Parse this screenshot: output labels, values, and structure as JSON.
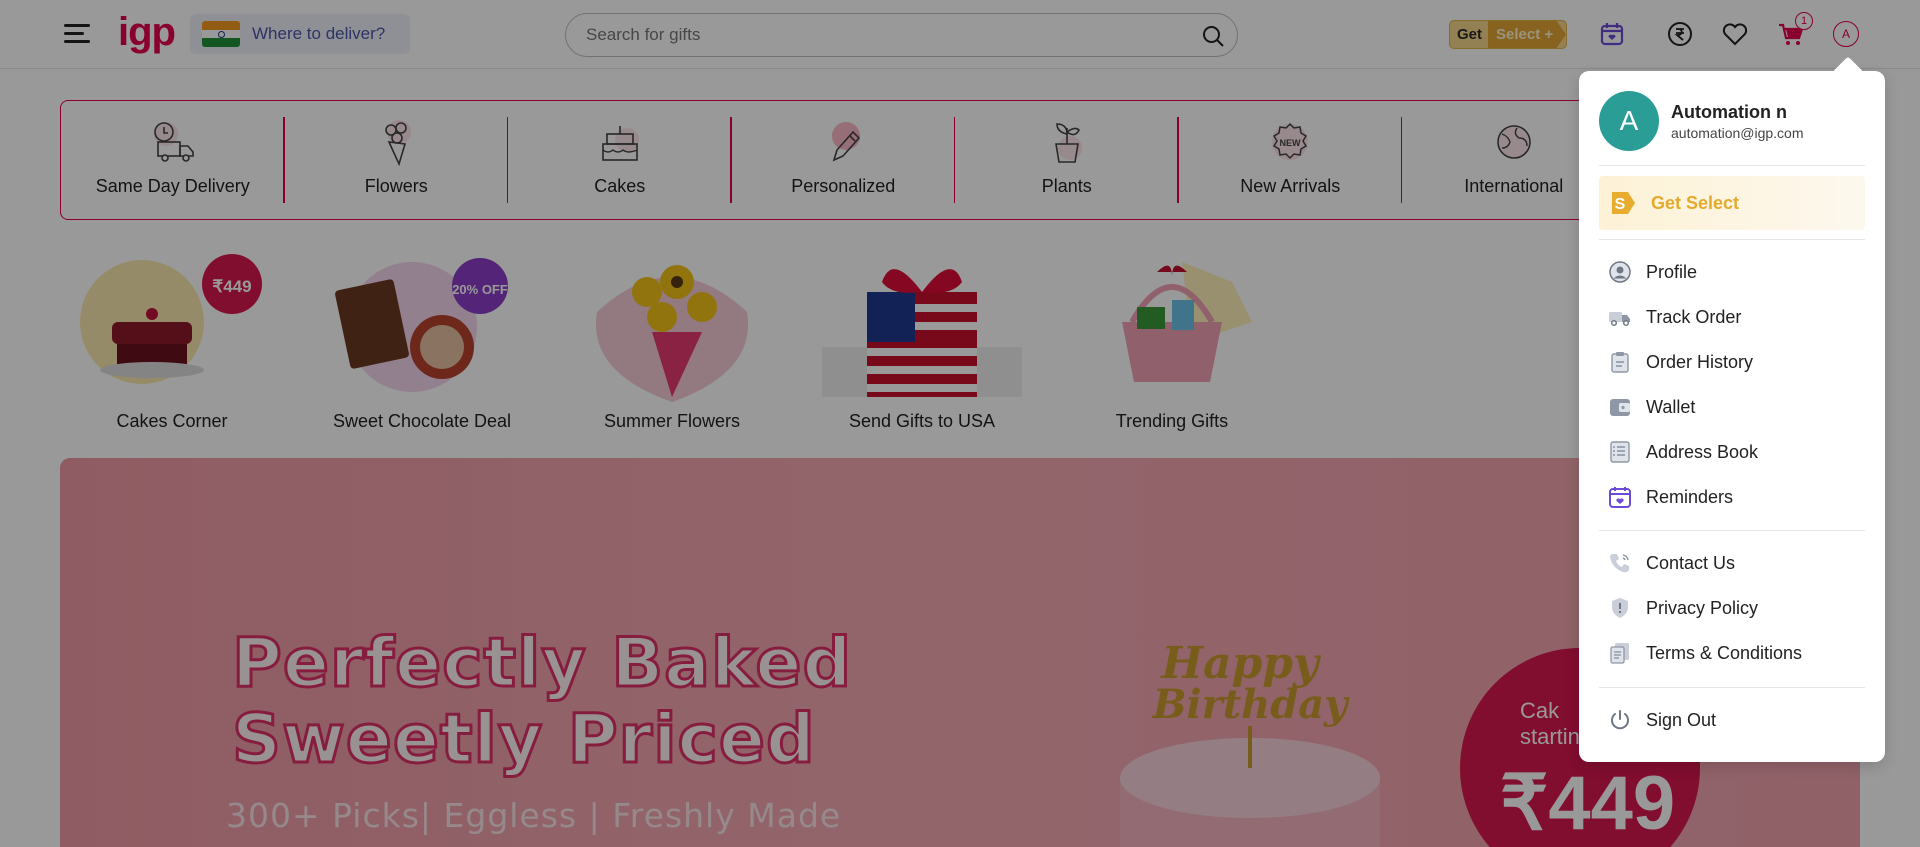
{
  "header": {
    "logo": "igp",
    "deliver_label": "Where to deliver?",
    "search_placeholder": "Search for gifts",
    "get_select": [
      "Get",
      "Select +"
    ],
    "cart_count": "1",
    "avatar_letter": "A"
  },
  "categories": [
    {
      "label": "Same Day Delivery",
      "icon": "delivery-truck-icon"
    },
    {
      "label": "Flowers",
      "icon": "flowers-icon"
    },
    {
      "label": "Cakes",
      "icon": "cake-icon"
    },
    {
      "label": "Personalized",
      "icon": "pen-icon"
    },
    {
      "label": "Plants",
      "icon": "plant-icon"
    },
    {
      "label": "New Arrivals",
      "icon": "new-badge-icon"
    },
    {
      "label": "International",
      "icon": "globe-icon"
    },
    {
      "label": "",
      "icon": ""
    }
  ],
  "tiles": [
    {
      "label": "Cakes Corner",
      "badge": "₹449"
    },
    {
      "label": "Sweet Chocolate Deal",
      "badge": "20% OFF"
    },
    {
      "label": "Summer Flowers"
    },
    {
      "label": "Send Gifts to USA"
    },
    {
      "label": "Trending Gifts"
    }
  ],
  "banner": {
    "title_line1": "Perfectly Baked",
    "title_line2": "Sweetly Priced",
    "subtitle": "300+ Picks| Eggless | Freshly Made",
    "price_text_1": "Cak",
    "price_text_2": "startin",
    "price_value": "₹449"
  },
  "account_menu": {
    "avatar_letter": "A",
    "name": "Automation n",
    "email": "automation@igp.com",
    "get_select": "Get Select",
    "items": [
      {
        "label": "Profile",
        "icon": "profile-icon"
      },
      {
        "label": "Track Order",
        "icon": "truck-icon"
      },
      {
        "label": "Order History",
        "icon": "clipboard-icon"
      },
      {
        "label": "Wallet",
        "icon": "wallet-icon"
      },
      {
        "label": "Address Book",
        "icon": "address-book-icon"
      },
      {
        "label": "Reminders",
        "icon": "calendar-heart-icon"
      }
    ],
    "support_items": [
      {
        "label": "Contact Us",
        "icon": "phone-icon"
      },
      {
        "label": "Privacy Policy",
        "icon": "shield-icon"
      },
      {
        "label": "Terms & Conditions",
        "icon": "document-icon"
      }
    ],
    "sign_out": "Sign Out"
  }
}
